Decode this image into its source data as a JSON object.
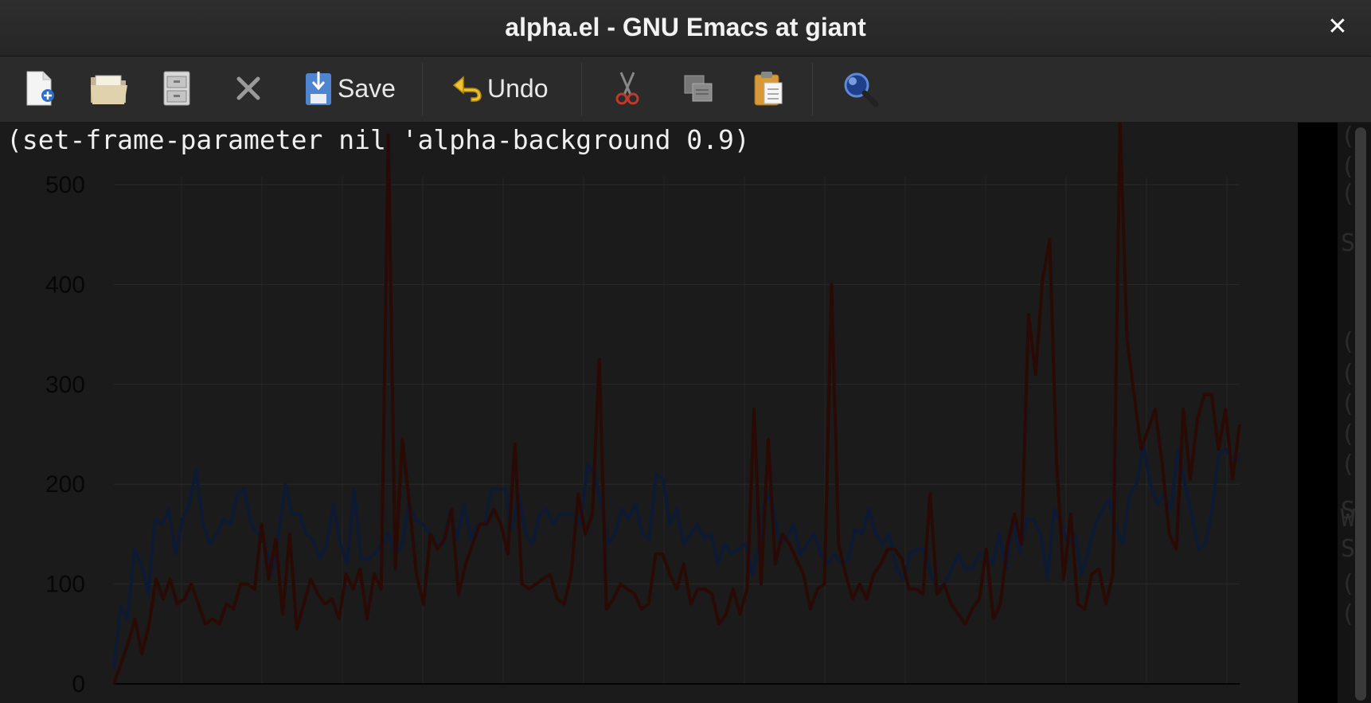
{
  "window": {
    "title": "alpha.el - GNU Emacs at giant",
    "close_glyph": "✕"
  },
  "toolbar": {
    "new_icon": "new-file-icon",
    "open_icon": "open-folder-icon",
    "dired_icon": "file-cabinet-icon",
    "close_icon": "close-buffer-icon",
    "save_label": "Save",
    "undo_label": "Undo",
    "cut_icon": "scissors-icon",
    "copy_icon": "copy-icon",
    "paste_icon": "paste-icon",
    "search_icon": "search-icon"
  },
  "editor": {
    "code_line": "(set-frame-parameter nil 'alpha-background 0.9)"
  },
  "chart_data": {
    "type": "line",
    "ylim": [
      0,
      500
    ],
    "yticks": [
      "0",
      "100",
      "200",
      "300",
      "400",
      "500"
    ],
    "grid": true,
    "series": [
      {
        "color": "#0d1a33",
        "values": [
          15,
          78,
          65,
          135,
          120,
          90,
          165,
          160,
          175,
          130,
          165,
          180,
          215,
          160,
          140,
          150,
          165,
          160,
          190,
          195,
          160,
          150,
          140,
          110,
          150,
          200,
          170,
          170,
          150,
          145,
          125,
          140,
          180,
          140,
          120,
          195,
          125,
          125,
          130,
          140,
          150,
          130,
          140,
          180,
          165,
          160,
          150,
          140,
          140,
          175,
          145,
          180,
          145,
          160,
          160,
          195,
          195,
          195,
          155,
          190,
          150,
          140,
          170,
          175,
          160,
          170,
          170,
          170,
          160,
          220,
          210,
          180,
          140,
          150,
          175,
          165,
          180,
          150,
          145,
          210,
          205,
          160,
          175,
          140,
          150,
          160,
          145,
          150,
          120,
          140,
          130,
          135,
          140,
          110,
          140,
          190,
          180,
          140,
          145,
          160,
          130,
          140,
          150,
          130,
          120,
          130,
          120,
          125,
          155,
          150,
          175,
          150,
          140,
          150,
          115,
          105,
          130,
          135,
          135,
          110,
          95,
          100,
          115,
          130,
          115,
          115,
          130,
          130,
          120,
          150,
          115,
          165,
          130,
          165,
          165,
          150,
          105,
          175,
          160,
          140,
          150,
          110,
          135,
          160,
          175,
          185,
          155,
          140,
          190,
          200,
          240,
          200,
          180,
          190,
          175,
          235,
          200,
          170,
          135,
          140,
          175,
          230,
          235,
          225,
          225
        ]
      },
      {
        "color": "#2a0a05",
        "values": [
          0,
          20,
          40,
          65,
          30,
          60,
          105,
          85,
          105,
          80,
          85,
          100,
          80,
          60,
          65,
          60,
          80,
          75,
          100,
          100,
          95,
          160,
          105,
          145,
          70,
          150,
          55,
          80,
          105,
          90,
          80,
          85,
          65,
          110,
          95,
          115,
          65,
          110,
          95,
          550,
          115,
          245,
          180,
          110,
          80,
          150,
          135,
          145,
          175,
          90,
          120,
          140,
          160,
          160,
          175,
          160,
          130,
          240,
          100,
          95,
          100,
          105,
          110,
          85,
          80,
          110,
          190,
          150,
          170,
          325,
          75,
          85,
          100,
          95,
          90,
          75,
          80,
          130,
          130,
          110,
          95,
          120,
          80,
          95,
          95,
          90,
          60,
          70,
          95,
          70,
          95,
          275,
          100,
          245,
          120,
          150,
          140,
          125,
          110,
          75,
          95,
          100,
          400,
          140,
          110,
          85,
          100,
          85,
          110,
          120,
          135,
          135,
          125,
          95,
          95,
          90,
          190,
          90,
          100,
          80,
          70,
          60,
          75,
          85,
          135,
          65,
          80,
          140,
          170,
          140,
          370,
          310,
          405,
          445,
          220,
          105,
          170,
          80,
          75,
          110,
          115,
          80,
          110,
          575,
          345,
          290,
          235,
          255,
          275,
          220,
          150,
          135,
          275,
          205,
          265,
          290,
          290,
          235,
          275,
          205,
          260
        ]
      }
    ]
  }
}
